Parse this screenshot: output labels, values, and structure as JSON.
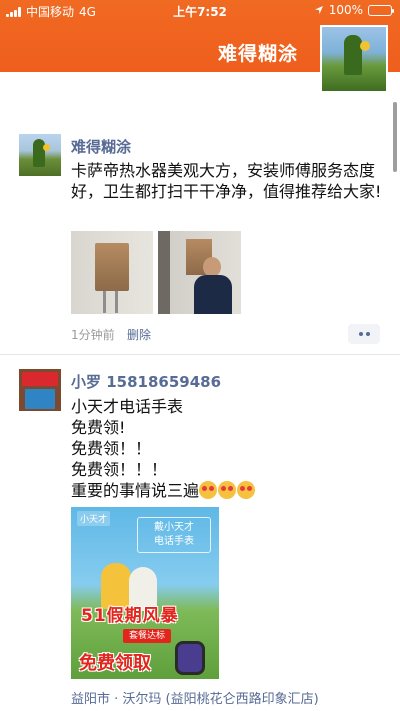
{
  "status_bar": {
    "carrier": "中国移动",
    "network": "4G",
    "time": "上午7:52",
    "battery": "100%"
  },
  "profile": {
    "name": "难得糊涂"
  },
  "posts": [
    {
      "author": "难得糊涂",
      "text": "卡萨帝热水器美观大方，安装师傅服务态度好，卫生都打扫干干净净，值得推荐给大家!",
      "time": "1分钟前",
      "delete_label": "删除"
    },
    {
      "author": "小罗 15818659486",
      "lines": [
        "小天才电话手表",
        "免费领!",
        "免费领！！",
        "免费领！！！",
        "重要的事情说三遍"
      ],
      "ad": {
        "brand": "小天才",
        "title_line1": "戴小天才",
        "title_line2": "电话手表",
        "slogan": "51假期风暴",
        "badge": "套餐达标",
        "cta": "免费领取"
      },
      "location": "益阳市 · 沃尔玛 (益阳桃花仑西路印象汇店)"
    }
  ]
}
